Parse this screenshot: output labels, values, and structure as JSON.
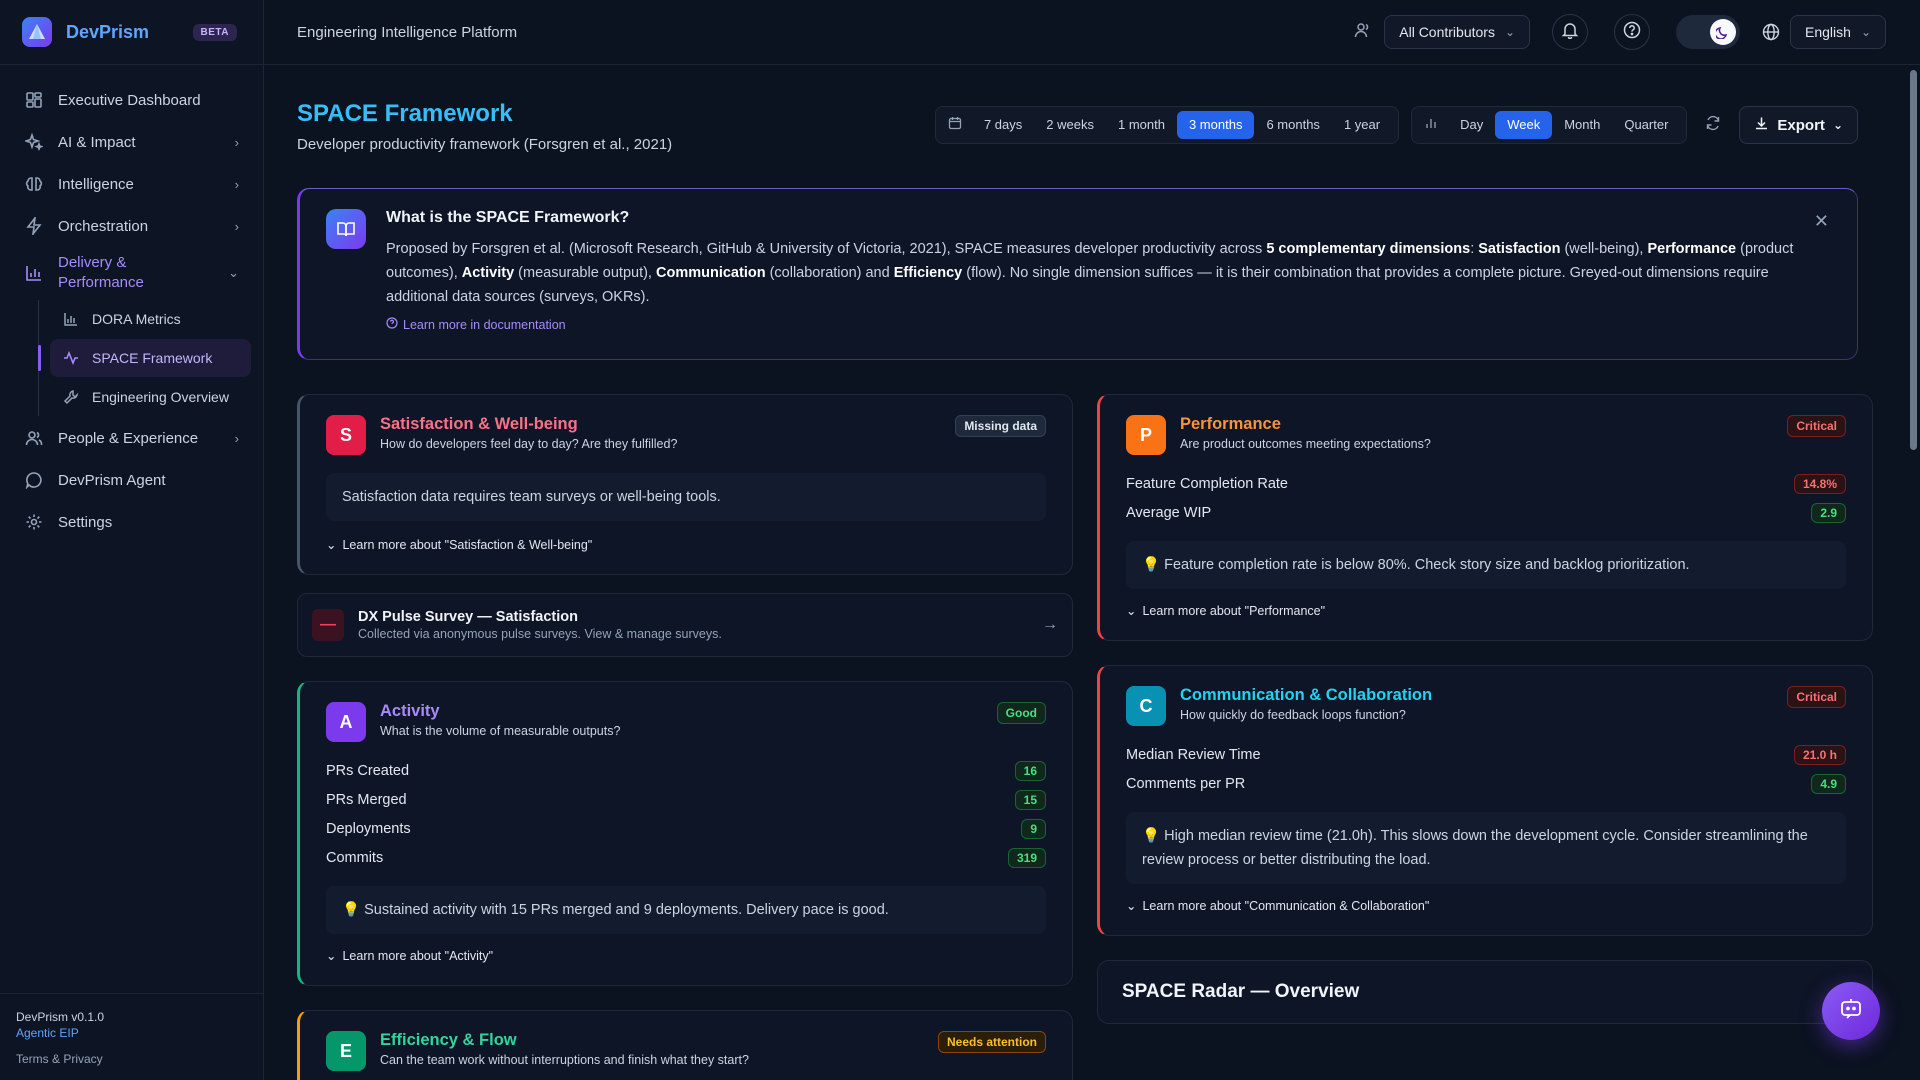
{
  "brand": {
    "name": "DevPrism",
    "badge": "BETA"
  },
  "sidebar": {
    "items": [
      {
        "label": "Executive Dashboard"
      },
      {
        "label": "AI & Impact"
      },
      {
        "label": "Intelligence"
      },
      {
        "label": "Orchestration"
      },
      {
        "label": "Delivery & Performance"
      },
      {
        "label": "People & Experience"
      },
      {
        "label": "DevPrism Agent"
      },
      {
        "label": "Settings"
      }
    ],
    "sub_items": [
      {
        "label": "DORA Metrics"
      },
      {
        "label": "SPACE Framework"
      },
      {
        "label": "Engineering Overview"
      }
    ],
    "footer": {
      "version": "DevPrism v0.1.0",
      "agentic": "Agentic EIP",
      "terms": "Terms & Privacy"
    }
  },
  "header": {
    "platform": "Engineering Intelligence Platform",
    "contributors": "All Contributors",
    "language": "English"
  },
  "page": {
    "title": "SPACE Framework",
    "subtitle": "Developer productivity framework (Forsgren et al., 2021)",
    "ranges": [
      "7 days",
      "2 weeks",
      "1 month",
      "3 months",
      "6 months",
      "1 year"
    ],
    "active_range": "3 months",
    "granularity": [
      "Day",
      "Week",
      "Month",
      "Quarter"
    ],
    "active_granularity": "Week",
    "export_label": "Export"
  },
  "info": {
    "title": "What is the SPACE Framework?",
    "t1": "Proposed by Forsgren et al. (Microsoft Research, GitHub & University of Victoria, 2021), SPACE measures developer productivity across ",
    "b1": "5 complementary dimensions",
    "t2": ": ",
    "b2": "Satisfaction",
    "t3": " (well-being), ",
    "b3": "Performance",
    "t4": " (product outcomes), ",
    "b4": "Activity",
    "t5": " (measurable output), ",
    "b5": "Communication",
    "t6": " (collaboration) and ",
    "b6": "Efficiency",
    "t7": " (flow). No single dimension suffices — it is their combination that provides a complete picture. Greyed-out dimensions require additional data sources (surveys, OKRs).",
    "link": "Learn more in documentation"
  },
  "cards": {
    "satisfaction": {
      "letter": "S",
      "title": "Satisfaction & Well-being",
      "subtitle": "How do developers feel day to day? Are they fulfilled?",
      "badge": "Missing data",
      "note": "Satisfaction data requires team surveys or well-being tools.",
      "learn": "Learn more about \"Satisfaction & Well-being\""
    },
    "dx": {
      "icon": "—",
      "title": "DX Pulse Survey — Satisfaction",
      "subtitle": "Collected via anonymous pulse surveys. View & manage surveys.",
      "arrow": "→"
    },
    "performance": {
      "letter": "P",
      "title": "Performance",
      "subtitle": "Are product outcomes meeting expectations?",
      "badge": "Critical",
      "metrics": [
        {
          "label": "Feature Completion Rate",
          "value": "14.8%"
        },
        {
          "label": "Average WIP",
          "value": "2.9"
        }
      ],
      "hint": "Feature completion rate is below 80%. Check story size and backlog prioritization.",
      "learn": "Learn more about \"Performance\""
    },
    "activity": {
      "letter": "A",
      "title": "Activity",
      "subtitle": "What is the volume of measurable outputs?",
      "badge": "Good",
      "metrics": [
        {
          "label": "PRs Created",
          "value": "16"
        },
        {
          "label": "PRs Merged",
          "value": "15"
        },
        {
          "label": "Deployments",
          "value": "9"
        },
        {
          "label": "Commits",
          "value": "319"
        }
      ],
      "hint": "Sustained activity with 15 PRs merged and 9 deployments. Delivery pace is good.",
      "learn": "Learn more about \"Activity\""
    },
    "communication": {
      "letter": "C",
      "title": "Communication & Collaboration",
      "subtitle": "How quickly do feedback loops function?",
      "badge": "Critical",
      "metrics": [
        {
          "label": "Median Review Time",
          "value": "21.0 h"
        },
        {
          "label": "Comments per PR",
          "value": "4.9"
        }
      ],
      "hint": "High median review time (21.0h). This slows down the development cycle. Consider streamlining the review process or better distributing the load.",
      "learn": "Learn more about \"Communication & Collaboration\""
    },
    "efficiency": {
      "letter": "E",
      "title": "Efficiency & Flow",
      "subtitle": "Can the team work without interruptions and finish what they start?",
      "badge": "Needs attention"
    },
    "radar": {
      "title": "SPACE Radar — Overview"
    }
  },
  "colors": {
    "satisfaction": "#f43f5e",
    "performance": "#f97316",
    "activity": "#8b5cf6",
    "communication": "#06b6d4",
    "efficiency": "#10b981",
    "efficiency_border": "#f59e0b"
  }
}
